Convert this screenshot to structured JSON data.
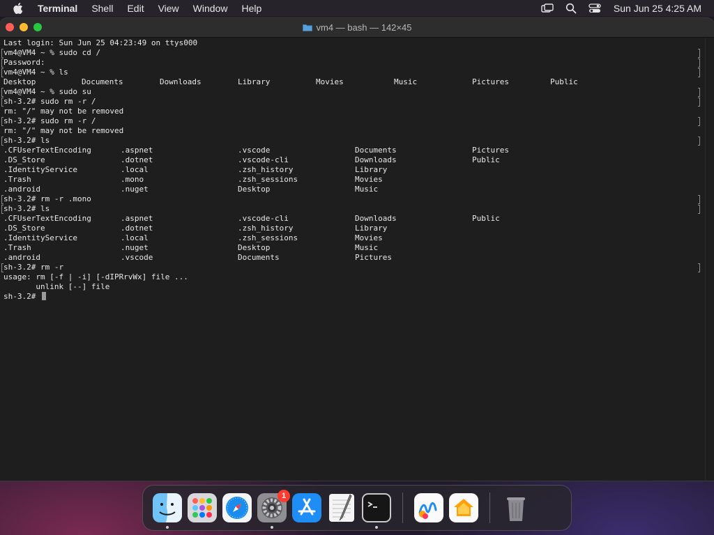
{
  "menubar": {
    "app_name": "Terminal",
    "items": [
      "Shell",
      "Edit",
      "View",
      "Window",
      "Help"
    ],
    "clock": "Sun Jun 25  4:25 AM"
  },
  "window": {
    "title": "vm4 — bash — 142×45"
  },
  "terminal": {
    "lines": [
      {
        "text": "Last login: Sun Jun 25 04:23:49 on ttys000",
        "marked": false
      },
      {
        "text": "vm4@VM4 ~ % sudo cd /",
        "marked": true
      },
      {
        "text": "Password:",
        "marked": true
      },
      {
        "text": "vm4@VM4 ~ % ls",
        "marked": true
      },
      {
        "cols": [
          "Desktop",
          "Documents",
          "Downloads",
          "Library",
          "Movies",
          "Music",
          "Pictures",
          "Public"
        ],
        "widths": [
          112,
          112,
          112,
          112,
          112,
          112,
          112,
          112
        ],
        "marked": false
      },
      {
        "text": "vm4@VM4 ~ % sudo su",
        "marked": true
      },
      {
        "text": "sh-3.2# sudo rm -r /",
        "marked": true
      },
      {
        "text": "rm: \"/\" may not be removed",
        "marked": false
      },
      {
        "text": "sh-3.2# sudo rm -r /",
        "marked": true
      },
      {
        "text": "rm: \"/\" may not be removed",
        "marked": false
      },
      {
        "text": "sh-3.2# ls",
        "marked": true
      },
      {
        "cols": [
          ".CFUserTextEncoding",
          ".aspnet",
          ".vscode",
          "Documents",
          "Pictures"
        ],
        "widths": [
          168,
          168,
          168,
          168,
          168
        ],
        "marked": false
      },
      {
        "cols": [
          ".DS_Store",
          ".dotnet",
          ".vscode-cli",
          "Downloads",
          "Public"
        ],
        "widths": [
          168,
          168,
          168,
          168,
          168
        ],
        "marked": false
      },
      {
        "cols": [
          ".IdentityService",
          ".local",
          ".zsh_history",
          "Library"
        ],
        "widths": [
          168,
          168,
          168,
          168
        ],
        "marked": false
      },
      {
        "cols": [
          ".Trash",
          ".mono",
          ".zsh_sessions",
          "Movies"
        ],
        "widths": [
          168,
          168,
          168,
          168
        ],
        "marked": false
      },
      {
        "cols": [
          ".android",
          ".nuget",
          "Desktop",
          "Music"
        ],
        "widths": [
          168,
          168,
          168,
          168
        ],
        "marked": false
      },
      {
        "text": "sh-3.2# rm -r .mono",
        "marked": true
      },
      {
        "text": "sh-3.2# ls",
        "marked": true
      },
      {
        "cols": [
          ".CFUserTextEncoding",
          ".aspnet",
          ".vscode-cli",
          "Downloads",
          "Public"
        ],
        "widths": [
          168,
          168,
          168,
          168,
          168
        ],
        "marked": false
      },
      {
        "cols": [
          ".DS_Store",
          ".dotnet",
          ".zsh_history",
          "Library"
        ],
        "widths": [
          168,
          168,
          168,
          168
        ],
        "marked": false
      },
      {
        "cols": [
          ".IdentityService",
          ".local",
          ".zsh_sessions",
          "Movies"
        ],
        "widths": [
          168,
          168,
          168,
          168
        ],
        "marked": false
      },
      {
        "cols": [
          ".Trash",
          ".nuget",
          "Desktop",
          "Music"
        ],
        "widths": [
          168,
          168,
          168,
          168
        ],
        "marked": false
      },
      {
        "cols": [
          ".android",
          ".vscode",
          "Documents",
          "Pictures"
        ],
        "widths": [
          168,
          168,
          168,
          168
        ],
        "marked": false
      },
      {
        "text": "sh-3.2# rm -r",
        "marked": true
      },
      {
        "text": "usage: rm [-f | -i] [-dIPRrvWx] file ...",
        "marked": false
      },
      {
        "text": "       unlink [--] file",
        "marked": false
      },
      {
        "text": "sh-3.2# ",
        "marked": false,
        "cursor": true
      }
    ]
  },
  "dock": {
    "apps": [
      {
        "name": "Finder",
        "icon": "finder-icon",
        "running": true
      },
      {
        "name": "Launchpad",
        "icon": "launchpad-icon",
        "running": false
      },
      {
        "name": "Safari",
        "icon": "safari-icon",
        "running": false
      },
      {
        "name": "System Settings",
        "icon": "settings-icon",
        "running": true,
        "badge": "1"
      },
      {
        "name": "App Store",
        "icon": "app-store-icon",
        "running": false
      },
      {
        "name": "TextEdit",
        "icon": "textedit-icon",
        "running": false
      },
      {
        "name": "Terminal",
        "icon": "terminal-icon",
        "running": true
      },
      {
        "name": "Freeform",
        "icon": "freeform-icon",
        "running": false
      },
      {
        "name": "Home",
        "icon": "home-icon",
        "running": false
      },
      {
        "name": "Trash",
        "icon": "trash-icon",
        "running": false
      }
    ]
  }
}
